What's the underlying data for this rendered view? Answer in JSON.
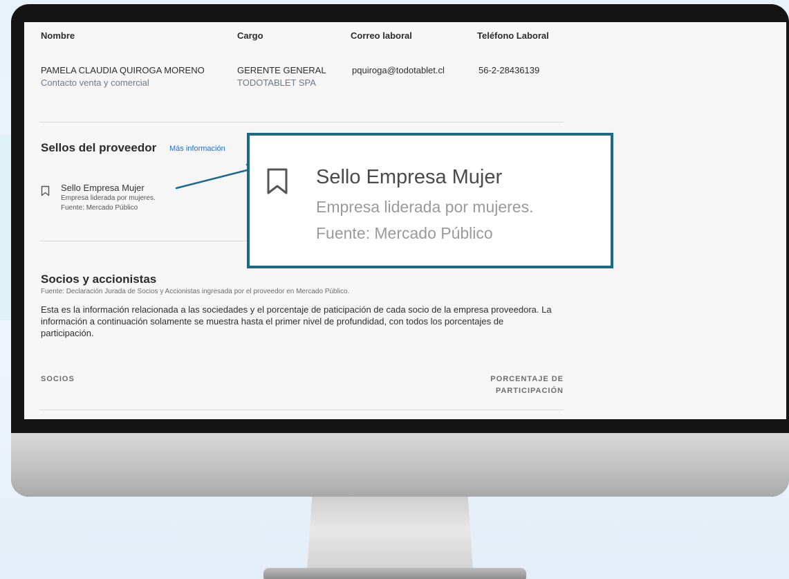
{
  "contact_table": {
    "headers": [
      "Nombre",
      "Cargo",
      "Correo laboral",
      "Teléfono Laboral"
    ],
    "row": {
      "name": "PAMELA CLAUDIA QUIROGA MORENO",
      "role_note": "Contacto venta y comercial",
      "cargo": "GERENTE GENERAL",
      "company": "TODOTABLET SPA",
      "email": "pquiroga@todotablet.cl",
      "phone": "56-2-28436139"
    }
  },
  "seals": {
    "title": "Sellos del proveedor",
    "more_info_link": "Más información",
    "item": {
      "icon": "bookmark-icon",
      "name": "Sello Empresa Mujer",
      "description": "Empresa liderada por mujeres.",
      "source": "Fuente: Mercado Público"
    }
  },
  "callout": {
    "icon": "bookmark-icon",
    "name": "Sello Empresa Mujer",
    "description": "Empresa liderada por mujeres.",
    "source": "Fuente: Mercado Público",
    "border_color": "#1a6a8a"
  },
  "partners": {
    "title": "Socios y accionistas",
    "source": "Fuente: Declaración Jurada de Socios y Accionistas ingresada por el proveedor en Mercado Público.",
    "description": "Esta es la información relacionada a las sociedades y el porcentaje de paticipación de cada socio de la empresa proveedora. La información a continuación solamente se muestra hasta el primer nivel de profundidad, con todos los porcentajes de participación.",
    "col_partners": "SOCIOS",
    "col_percentage_line1": "PORCENTAJE DE",
    "col_percentage_line2": "PARTICIPACIÓN"
  },
  "colors": {
    "link": "#1f6fd0",
    "callout_border": "#1a6a8a",
    "arrow": "#1a6a8a"
  }
}
